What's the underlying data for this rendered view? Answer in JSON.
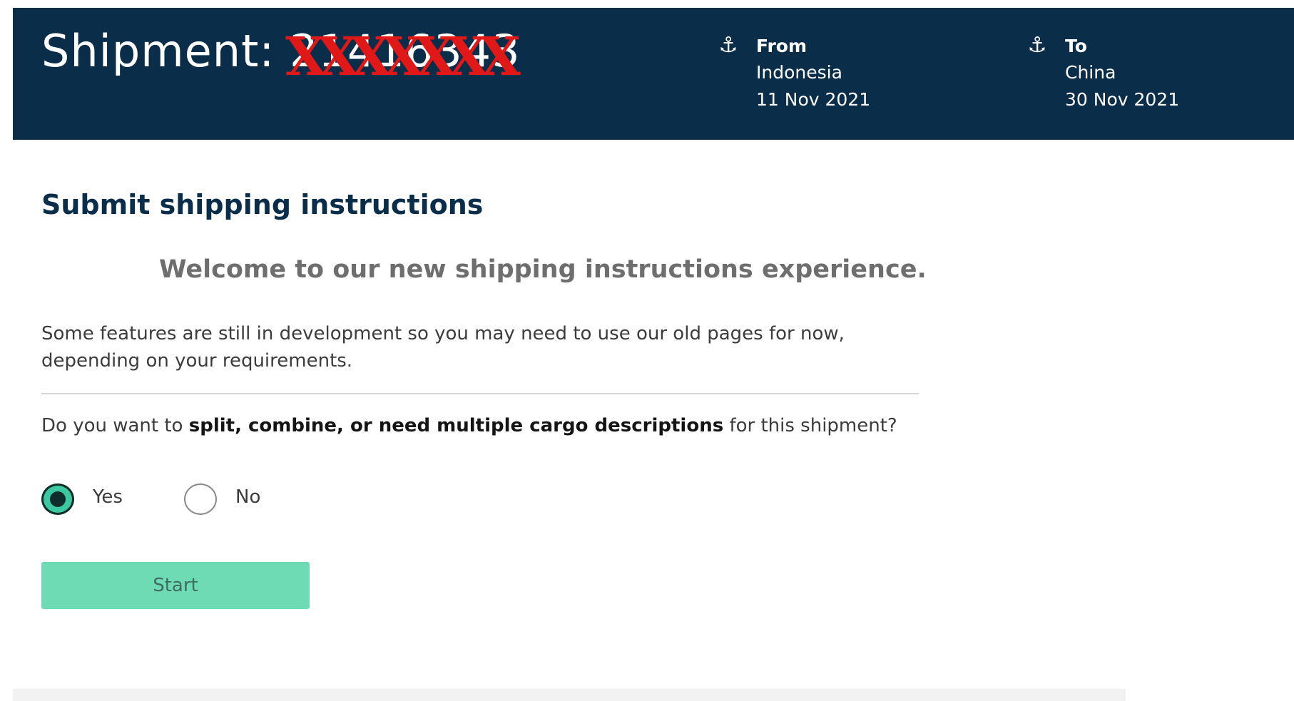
{
  "header": {
    "title_prefix": "Shipment: ",
    "shipment_number": "21416343",
    "redaction_mark": "XXXXXXX",
    "from": {
      "label": "From",
      "country": "Indonesia",
      "date": "11 Nov 2021",
      "icon": "anchor-icon"
    },
    "to": {
      "label": "To",
      "country": "China",
      "date": "30 Nov 2021",
      "icon": "anchor-icon"
    }
  },
  "main": {
    "title": "Submit shipping instructions",
    "welcome": "Welcome to our new shipping instructions experience.",
    "intro": "Some features are still in development so you may need to use our old pages for now, depending on your requirements.",
    "question": {
      "prefix": "Do you want to ",
      "emphasis": "split, combine, or need multiple cargo descriptions",
      "suffix": " for this shipment?"
    },
    "options": {
      "yes": "Yes",
      "no": "No",
      "selected": "yes"
    },
    "start_button": "Start"
  },
  "colors": {
    "header_bg": "#0a2d4a",
    "accent_green": "#6fdbb4",
    "redaction_red": "#e01818"
  }
}
